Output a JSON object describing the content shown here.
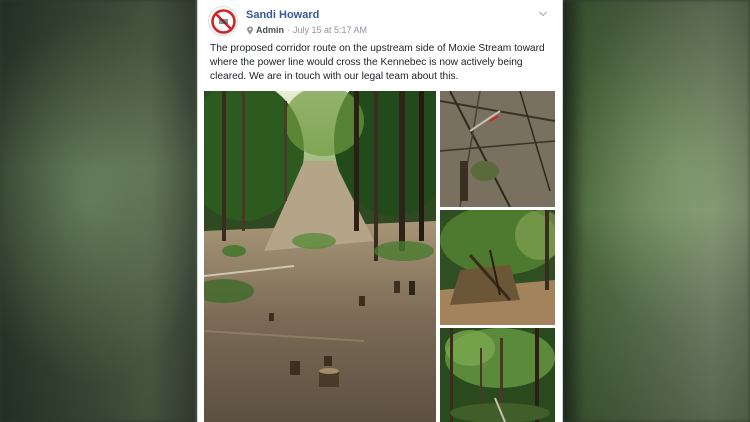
{
  "post": {
    "author": "Sandi Howard",
    "role": "Admin",
    "timestamp": "July 15 at 5:17 AM",
    "separator": "·",
    "body": "The proposed corridor route on the upstream side of Moxie Stream toward where the power line would cross the Kennebec is now actively being cleared. We are in touch with our legal team about this."
  },
  "icons": {
    "avatar": "no-symbol-avatar-icon",
    "admin": "pin-icon",
    "menu": "chevron-down-icon"
  },
  "colors": {
    "author_link": "#365899",
    "meta_text": "#90949c",
    "body_text": "#1d2129",
    "avatar_red": "#d0242b"
  }
}
